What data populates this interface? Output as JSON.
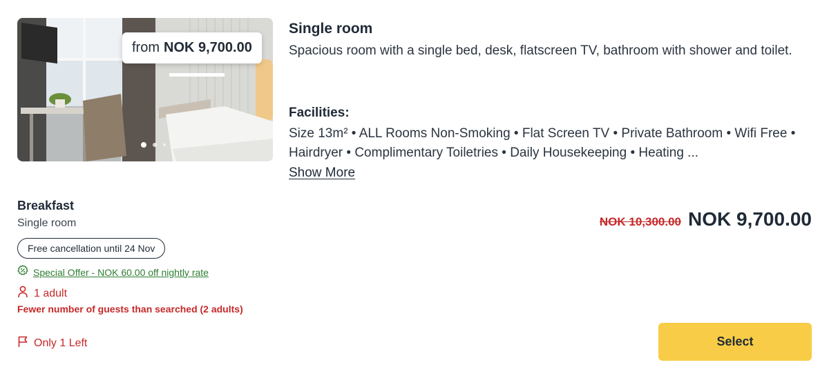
{
  "room": {
    "price_prefix": "from",
    "price_badge": "NOK 9,700.00",
    "title": "Single room",
    "description": "Spacious room with a single bed, desk, flatscreen TV, bathroom with shower and toilet.",
    "facilities_title": "Facilities:",
    "facilities_text": "Size 13m² • ALL Rooms Non-Smoking • Flat Screen TV • Private Bathroom • Wifi Free • Hairdryer • Complimentary Toiletries • Daily Housekeeping • Heating ...",
    "show_more": "Show More",
    "carousel": {
      "slides": 3,
      "active": 1
    }
  },
  "rate": {
    "title": "Breakfast",
    "subtitle": "Single room",
    "cancellation": "Free cancellation until 24 Nov",
    "offer": "Special Offer - NOK 60.00 off nightly rate",
    "guests": "1 adult",
    "guests_warning": "Fewer number of guests than searched (2 adults)",
    "availability": "Only 1 Left",
    "old_price": "NOK 10,300.00",
    "price": "NOK 9,700.00",
    "select_label": "Select"
  },
  "icons": {
    "offer": "badge-percent-icon",
    "guests": "person-icon",
    "availability": "flag-icon"
  },
  "colors": {
    "accent": "#f8cc46",
    "danger": "#c62828",
    "success": "#2e7d32",
    "text": "#1f2a37"
  }
}
